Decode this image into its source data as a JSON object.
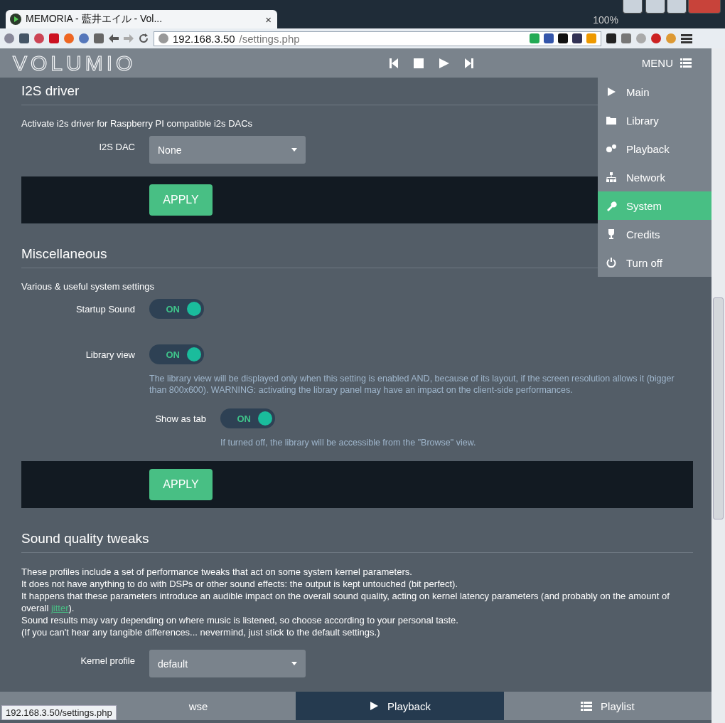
{
  "browser": {
    "tab_title": "MEMORIA - 藍井エイル - Vol...",
    "tab_close": "×",
    "zoom": "100%",
    "url_host": "192.168.3.50",
    "url_path": "/settings.php",
    "status_url": "192.168.3.50/settings.php"
  },
  "header": {
    "logo": "VOLUMIO",
    "menu_label": "MENU"
  },
  "menu": [
    {
      "label": "Main",
      "selected": false
    },
    {
      "label": "Library",
      "selected": false
    },
    {
      "label": "Playback",
      "selected": false
    },
    {
      "label": "Network",
      "selected": false
    },
    {
      "label": "System",
      "selected": true
    },
    {
      "label": "Credits",
      "selected": false
    },
    {
      "label": "Turn off",
      "selected": false
    }
  ],
  "sections": [
    {
      "title": "I2S driver",
      "description": "Activate i2s driver for Raspberry PI compatible i2s DACs",
      "rows": [
        {
          "kind": "select",
          "label": "I2S DAC",
          "value": "None"
        }
      ],
      "apply": "APPLY"
    },
    {
      "title": "Miscellaneous",
      "description": "Various & useful system settings",
      "rows": [
        {
          "kind": "toggle",
          "label": "Startup Sound",
          "on": true,
          "state_text": "ON"
        },
        {
          "kind": "toggle",
          "label": "Library view",
          "on": true,
          "state_text": "ON",
          "note": "The library view will be displayed only when this setting is enabled AND, because of its layout, if the screen resolution allows it (bigger than 800x600). WARNING: activating the library panel may have an impact on the client-side performances.",
          "children": [
            {
              "kind": "toggle",
              "label": "Show as tab",
              "on": true,
              "state_text": "ON",
              "note": "If turned off, the library will be accessible from the \"Browse\" view."
            }
          ]
        }
      ],
      "apply": "APPLY"
    },
    {
      "title": "Sound quality tweaks",
      "lines": [
        {
          "text": "These profiles include a set of performance tweaks that act on some system kernel parameters."
        },
        {
          "text": "It does not have anything to do with DSPs or other sound effects: the output is kept untouched (bit perfect)."
        },
        {
          "text": "It happens that these parameters introduce an audible impact on the overall sound quality, acting on kernel latency parameters (and probably on the amount of overall ",
          "link": "jitter",
          "after": ")."
        },
        {
          "text": "Sound results may vary depending on where music is listened, so choose according to your personal taste."
        },
        {
          "text": "(If you can't hear any tangible differences... nevermind, just stick to the default settings.)"
        }
      ],
      "rows": [
        {
          "kind": "select",
          "label": "Kernel profile",
          "value": "default"
        }
      ]
    }
  ],
  "bottom_nav": [
    {
      "label": "wse",
      "selected": false
    },
    {
      "label": "Playback",
      "selected": true
    },
    {
      "label": "Playlist",
      "selected": false
    }
  ]
}
